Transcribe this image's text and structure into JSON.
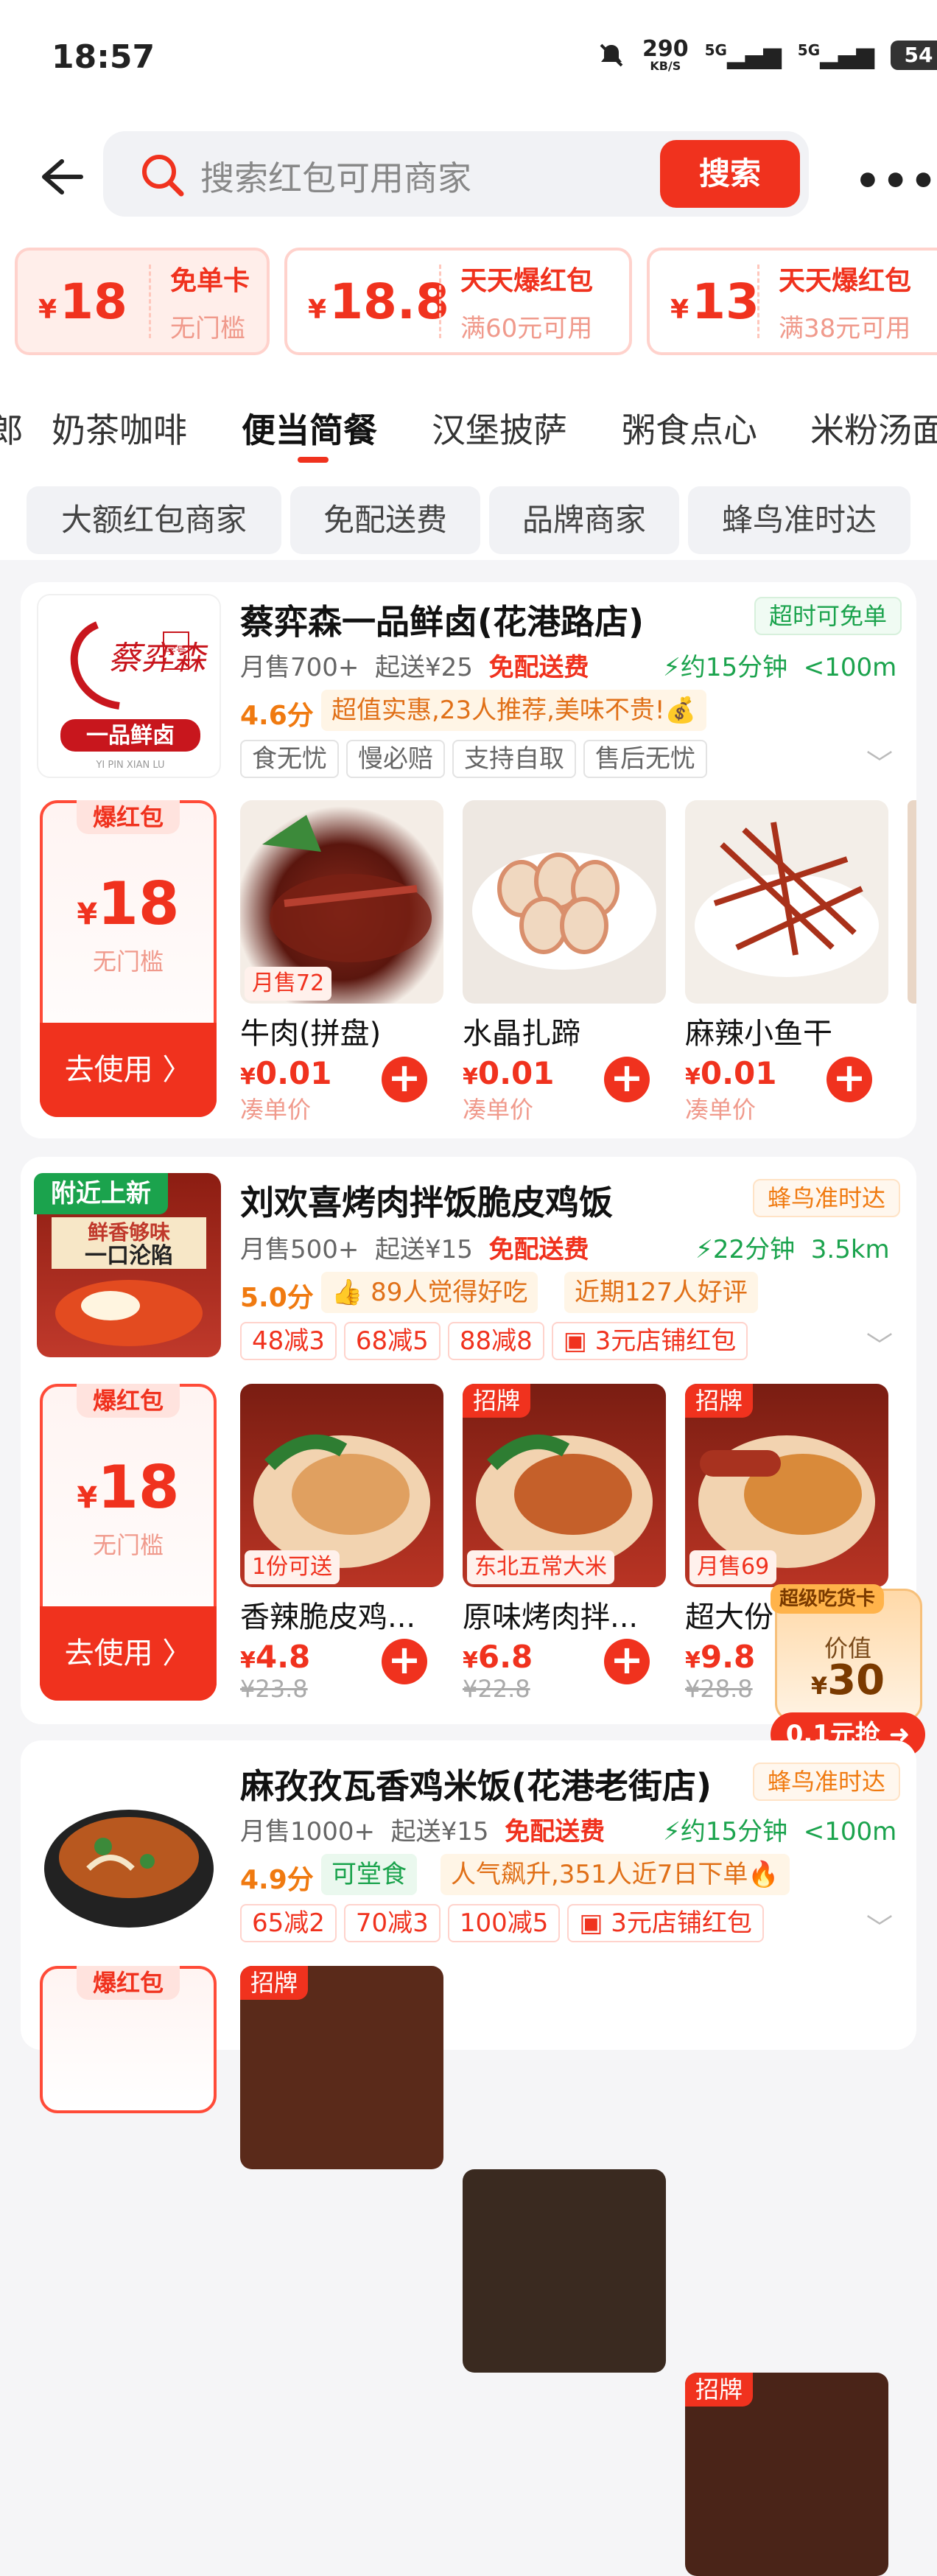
{
  "status": {
    "time": "18:57",
    "net": "290",
    "net_unit": "KB/S",
    "sig1": "5G",
    "sig2": "5G",
    "battery": "54"
  },
  "search": {
    "placeholder": "搜索红包可用商家",
    "button": "搜索"
  },
  "coupons": [
    {
      "currency": "¥",
      "amount": "18",
      "title": "免单卡",
      "cond": "无门槛"
    },
    {
      "currency": "¥",
      "amount": "18.8",
      "title": "天天爆红包",
      "cond": "满60元可用"
    },
    {
      "currency": "¥",
      "amount": "13",
      "title": "天天爆红包",
      "cond": "满38元可用"
    }
  ],
  "categories": {
    "partial": "郎",
    "items": [
      "奶茶咖啡",
      "便当简餐",
      "汉堡披萨",
      "粥食点心",
      "米粉汤面"
    ]
  },
  "filters": [
    "大额红包商家",
    "免配送费",
    "品牌商家",
    "蜂鸟准时达"
  ],
  "stores": [
    {
      "name": "蔡弈森一品鲜卤(花港路店)",
      "tag": "超时可免单",
      "sales": "月售700+",
      "min": "起送¥25",
      "free": "免配送费",
      "time": "约15分钟",
      "dist": "<100m",
      "score": "4.6分",
      "pill1": "超值实惠,23人推荐,美味不贵!💰",
      "tags": [
        "食无忧",
        "慢必赔",
        "支持自取",
        "售后无忧"
      ],
      "logo": {
        "cn": "蔡弈森",
        "seal": "字号",
        "sub": "一品鲜卤",
        "en": "YI PIN XIAN LU"
      },
      "coupon": {
        "head": "爆红包",
        "currency": "¥",
        "value": "18",
        "cond": "无门槛",
        "use": "去使用 〉"
      },
      "dishes": [
        {
          "name": "牛肉(拼盘)",
          "price": "0.01",
          "sub": "凑单价",
          "badge_bot": "月售72"
        },
        {
          "name": "水晶扎蹄",
          "price": "0.01",
          "sub": "凑单价"
        },
        {
          "name": "麻辣小鱼干",
          "price": "0.01",
          "sub": "凑单价"
        }
      ]
    },
    {
      "name": "刘欢喜烤肉拌饭脆皮鸡饭",
      "tag": "蜂鸟准时达",
      "newbadge": "附近上新",
      "sales": "月售500+",
      "min": "起送¥15",
      "free": "免配送费",
      "time": "22分钟",
      "dist": "3.5km",
      "score": "5.0分",
      "pill1": "👍 89人觉得好吃",
      "pill2": "近期127人好评",
      "tags": [
        "48减3",
        "68减5",
        "88减8"
      ],
      "redtag": "3元店铺红包",
      "logo": {
        "l1": "鲜香够味",
        "l2": "一口沦陷"
      },
      "coupon": {
        "head": "爆红包",
        "currency": "¥",
        "value": "18",
        "cond": "无门槛",
        "use": "去使用 〉"
      },
      "dishes": [
        {
          "name": "香辣脆皮鸡...",
          "price": "4.8",
          "sub": "¥23.8",
          "badge_bot": "1份可送"
        },
        {
          "name": "原味烤肉拌...",
          "price": "6.8",
          "sub": "¥22.8",
          "badge_top": "招牌",
          "badge_bot": "东北五常大米"
        },
        {
          "name": "超大份...",
          "price": "9.8",
          "sub": "¥28.8",
          "badge_top": "招牌",
          "badge_bot": "月售69"
        }
      ]
    },
    {
      "name": "麻孜孜瓦香鸡米饭(花港老街店)",
      "tag": "蜂鸟准时达",
      "sales": "月售1000+",
      "min": "起送¥15",
      "free": "免配送费",
      "time": "约15分钟",
      "dist": "<100m",
      "score": "4.9分",
      "pill_green": "可堂食",
      "pill1": "人气飙升,351人近7日下单🔥",
      "tags": [
        "65减2",
        "70减3",
        "100减5"
      ],
      "redtag": "3元店铺红包",
      "coupon": {
        "head": "爆红包"
      },
      "dishes": [
        {
          "badge_top": "招牌"
        },
        {},
        {
          "badge_top": "招牌"
        }
      ]
    }
  ],
  "floating": {
    "title": "超级吃货卡",
    "label": "价值",
    "currency": "¥",
    "value": "30",
    "cta": "0.1元抢"
  },
  "colors": {
    "accent": "#f0321e",
    "green": "#1ba34d",
    "orange": "#f07a10"
  }
}
